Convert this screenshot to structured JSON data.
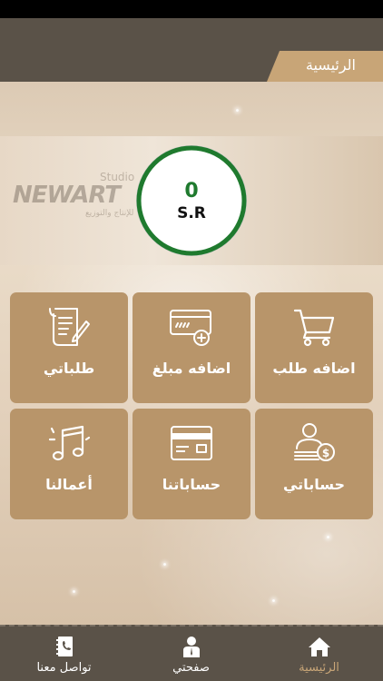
{
  "header": {
    "title": "الرئيسية"
  },
  "banner": {
    "logo_brand": "NEWART",
    "logo_studio": "Studio",
    "logo_tagline": "للإنتاج والتوزيع"
  },
  "balance": {
    "value": "0",
    "currency": "S.R"
  },
  "tiles": [
    {
      "label": "اضافه طلب",
      "icon": "cart-icon"
    },
    {
      "label": "اضافه مبلغ",
      "icon": "card-add-icon"
    },
    {
      "label": "طلباتي",
      "icon": "document-pen-icon"
    },
    {
      "label": "حساباتي",
      "icon": "user-money-icon"
    },
    {
      "label": "حساباتنا",
      "icon": "credit-card-icon"
    },
    {
      "label": "أعمالنا",
      "icon": "music-notes-icon"
    }
  ],
  "bottom_nav": [
    {
      "label": "الرئيسية",
      "icon": "home-icon",
      "active": true
    },
    {
      "label": "صفحتي",
      "icon": "person-icon",
      "active": false
    },
    {
      "label": "تواصل معنا",
      "icon": "contact-book-icon",
      "active": false
    }
  ],
  "colors": {
    "accent": "#c8a577",
    "tile": "#b8956a",
    "bar": "#5a5248",
    "ring": "#1f7a2e"
  }
}
